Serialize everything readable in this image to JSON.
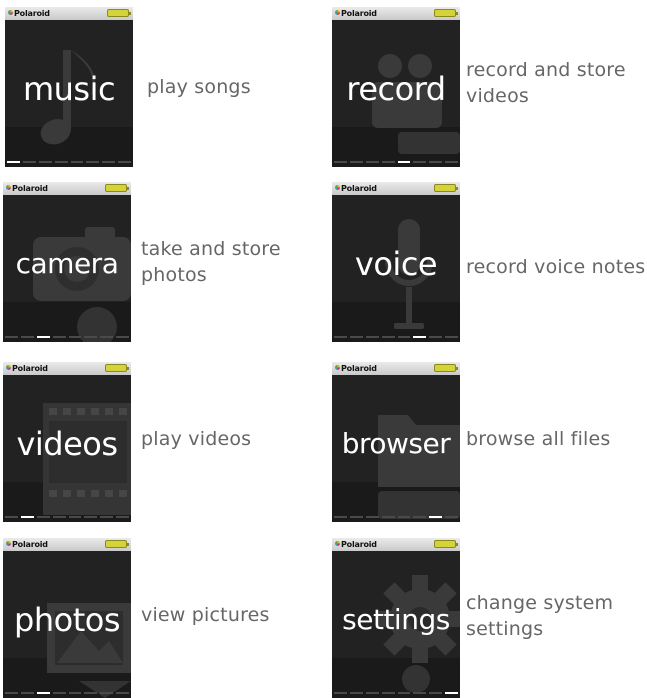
{
  "brand": "Polaroid",
  "colors": {
    "screen_bg": "#222222",
    "battery": "#d4d33a",
    "desc_text": "#666666"
  },
  "modes": [
    {
      "label": "music",
      "description": [
        "play songs"
      ],
      "icon": "music-note-icon",
      "active_dot": 0
    },
    {
      "label": "record",
      "description": [
        "record and store",
        "videos"
      ],
      "icon": "video-camera-icon",
      "active_dot": 4
    },
    {
      "label": "camera",
      "description": [
        "take and store",
        "photos"
      ],
      "icon": "camera-icon",
      "active_dot": 2
    },
    {
      "label": "voice",
      "description": [
        "record voice notes"
      ],
      "icon": "microphone-icon",
      "active_dot": 5
    },
    {
      "label": "videos",
      "description": [
        "play videos"
      ],
      "icon": "film-strip-icon",
      "active_dot": 1
    },
    {
      "label": "browser",
      "description": [
        "browse all files"
      ],
      "icon": "folder-icon",
      "active_dot": 6
    },
    {
      "label": "photos",
      "description": [
        "view pictures"
      ],
      "icon": "picture-icon",
      "active_dot": 2
    },
    {
      "label": "settings",
      "description": [
        "change system",
        "settings"
      ],
      "icon": "gear-icon",
      "active_dot": 7
    }
  ]
}
